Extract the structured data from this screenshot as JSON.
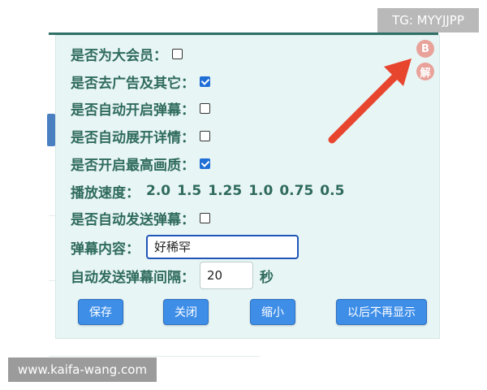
{
  "panel": {
    "rows": [
      {
        "label": "是否为大会员：",
        "checked": false
      },
      {
        "label": "是否去广告及其它：",
        "checked": true
      },
      {
        "label": "是否自动开启弹幕：",
        "checked": false
      },
      {
        "label": "是否自动展开详情：",
        "checked": false
      },
      {
        "label": "是否开启最高画质：",
        "checked": true
      }
    ],
    "speed": {
      "label": "播放速度：",
      "options": [
        "2.0",
        "1.5",
        "1.25",
        "1.0",
        "0.75",
        "0.5"
      ]
    },
    "auto_danmaku": {
      "label": "是否自动发送弹幕：",
      "checked": false
    },
    "danmaku_content": {
      "label": "弹幕内容：",
      "value": "好稀罕"
    },
    "interval": {
      "label": "自动发送弹幕间隔：",
      "value": "20",
      "unit": "秒"
    },
    "buttons": {
      "save": "保存",
      "close": "关闭",
      "minimize": "缩小",
      "never_show": "以后不再显示"
    }
  },
  "corner_icons": {
    "b": "B",
    "jie": "解"
  },
  "watermarks": {
    "tg": "TG: MYYJJPP",
    "site": "www.kaifa-wang.com"
  },
  "colors": {
    "label": "#2f6b5d",
    "panel_bg": "#e8f5f5",
    "button": "#3e8ee8",
    "arrow": "#e8452f",
    "corner_icon": "#e8a29a"
  }
}
